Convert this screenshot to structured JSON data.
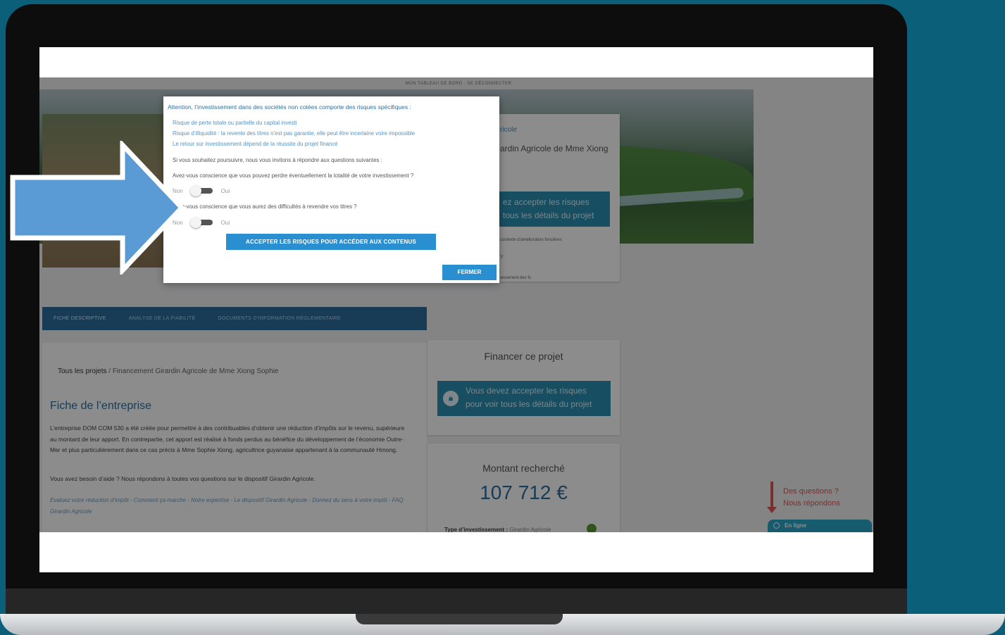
{
  "colors": {
    "background": "#0b5f78",
    "accent": "#2a8fd0",
    "tab_bar": "#2c6e9c",
    "annotation_arrow": "#5b9bd5",
    "help_note": "#e05555",
    "chat": "#29a7c9"
  },
  "topnav": {
    "label": "MON TABLEAU DE BORD · SE DÉCONNECTER"
  },
  "info_card": {
    "category": "ricole",
    "title": "ardin Agricole de Mme Xiong",
    "notice": "ez accepter les risques tous les détails du projet",
    "line1": "contexte d’amélioration foncières",
    "line2": "Y",
    "line3": "ancement des fs"
  },
  "tabs": [
    {
      "label": "FICHE DESCRIPTIVE"
    },
    {
      "label": "ANALYSE DE LA FIABILITÉ"
    },
    {
      "label": "DOCUMENTS D’INFORMATION RÉGLEMENTAIRE"
    }
  ],
  "main": {
    "breadcrumb_root": "Tous les projets",
    "breadcrumb_current": " / Financement Girardin Agricole de Mme Xiong Sophie",
    "heading": "Fiche de l’entreprise",
    "paragraph": "L’entreprise DOM COM 530 a été créée pour permettre à des contribuables d’obtenir une réduction d’impôts sur le revenu, supérieure au montant de leur apport. En contrepartie, cet apport est réalisé à fonds perdus au bénéfice du développement de l’économie Outre-Mer et plus particulièrement dans ce cas précis à Mme Sophie Xiong, agricultrice guyanaise appartenant à la communauté Hmong.",
    "help_text": "Vous avez besoin d’aide ? Nous répondons à toutes vos questions sur le dispositif Girardin Agricole.",
    "links": "Evaluez votre réduction d’impôt - Comment ça marche - Notre expertise - Le dispositif Girardin Agricole - Donnez du sens à votre impôt - FAQ Girardin Agricole"
  },
  "fund_card": {
    "title": "Financer ce projet",
    "button_line1": "Vous devez accepter les risques",
    "button_line2": "pour voir tous les détails du projet",
    "icon": "lock-icon"
  },
  "amount_card": {
    "title": "Montant recherché",
    "value": "107 712 €",
    "type_label": "Type d’investissement : ",
    "type_value": "Girardin Agricole"
  },
  "help_note": {
    "line1": "Des questions ?",
    "line2": "Nous répondons"
  },
  "chat": {
    "label": "En ligne",
    "icon": "chat-icon"
  },
  "modal": {
    "heading": "Attention, l’investissement dans des sociétés non cotées comporte des risques spécifiques :",
    "risks": [
      "Risque de perte totale ou partielle du capital investi",
      "Risque d’illiquidité : la revente des titres n’est pas garantie, elle peut être incertaine voire impossible",
      "Le retour sur investissement dépend de la réussite du projet financé"
    ],
    "intro": "Si vous souhaitez poursuivre, nous vous invitons à répondre aux questions suivantes :",
    "q1": "Avez-vous conscience que vous pouvez perdre éventuellement la totalité de votre investissement ?",
    "q2": "Avez-vous conscience que vous aurez des difficultés à revendre vos titres ?",
    "no_label": "Non",
    "yes_label": "Oui",
    "accept_button": "ACCEPTER LES RISQUES POUR ACCÉDER AUX CONTENUS",
    "close_button": "FERMER"
  }
}
